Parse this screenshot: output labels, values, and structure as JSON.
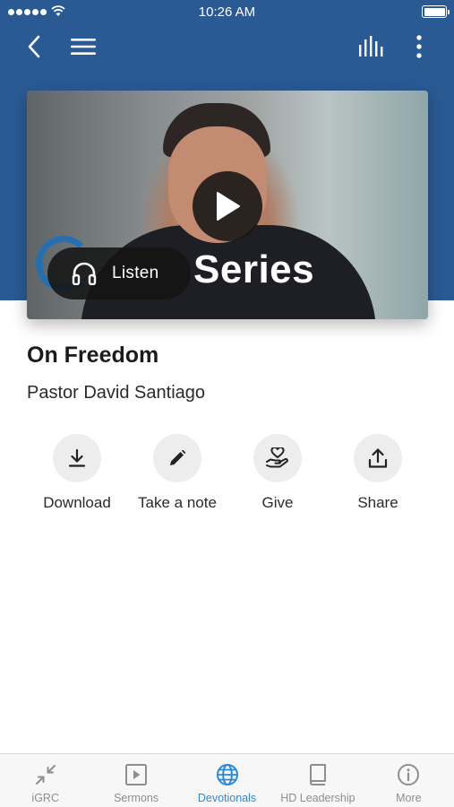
{
  "status_bar": {
    "time": "10:26 AM"
  },
  "top_nav": {
    "back_icon": "chevron-left-icon",
    "menu_icon": "hamburger-menu-icon",
    "audio_icon": "audio-bars-icon",
    "more_icon": "vertical-dots-icon"
  },
  "colors": {
    "header": "#2a5a94",
    "accent": "#2b8ad6",
    "action_bg": "#ededed"
  },
  "video": {
    "overlay_text": "Series",
    "listen_label": "Listen"
  },
  "sermon": {
    "title": "On Freedom",
    "speaker": "Pastor David Santiago"
  },
  "actions": [
    {
      "label": "Download",
      "icon": "download-icon"
    },
    {
      "label": "Take a note",
      "icon": "pencil-icon"
    },
    {
      "label": "Give",
      "icon": "give-heart-hand-icon"
    },
    {
      "label": "Share",
      "icon": "share-upload-icon"
    }
  ],
  "tabs": [
    {
      "label": "iGRC",
      "icon": "collapse-arrows-icon",
      "active": false
    },
    {
      "label": "Sermons",
      "icon": "play-square-icon",
      "active": false
    },
    {
      "label": "Devotionals",
      "icon": "globe-icon",
      "active": true
    },
    {
      "label": "HD Leadership",
      "icon": "book-icon",
      "active": false
    },
    {
      "label": "More",
      "icon": "info-circle-icon",
      "active": false
    }
  ]
}
